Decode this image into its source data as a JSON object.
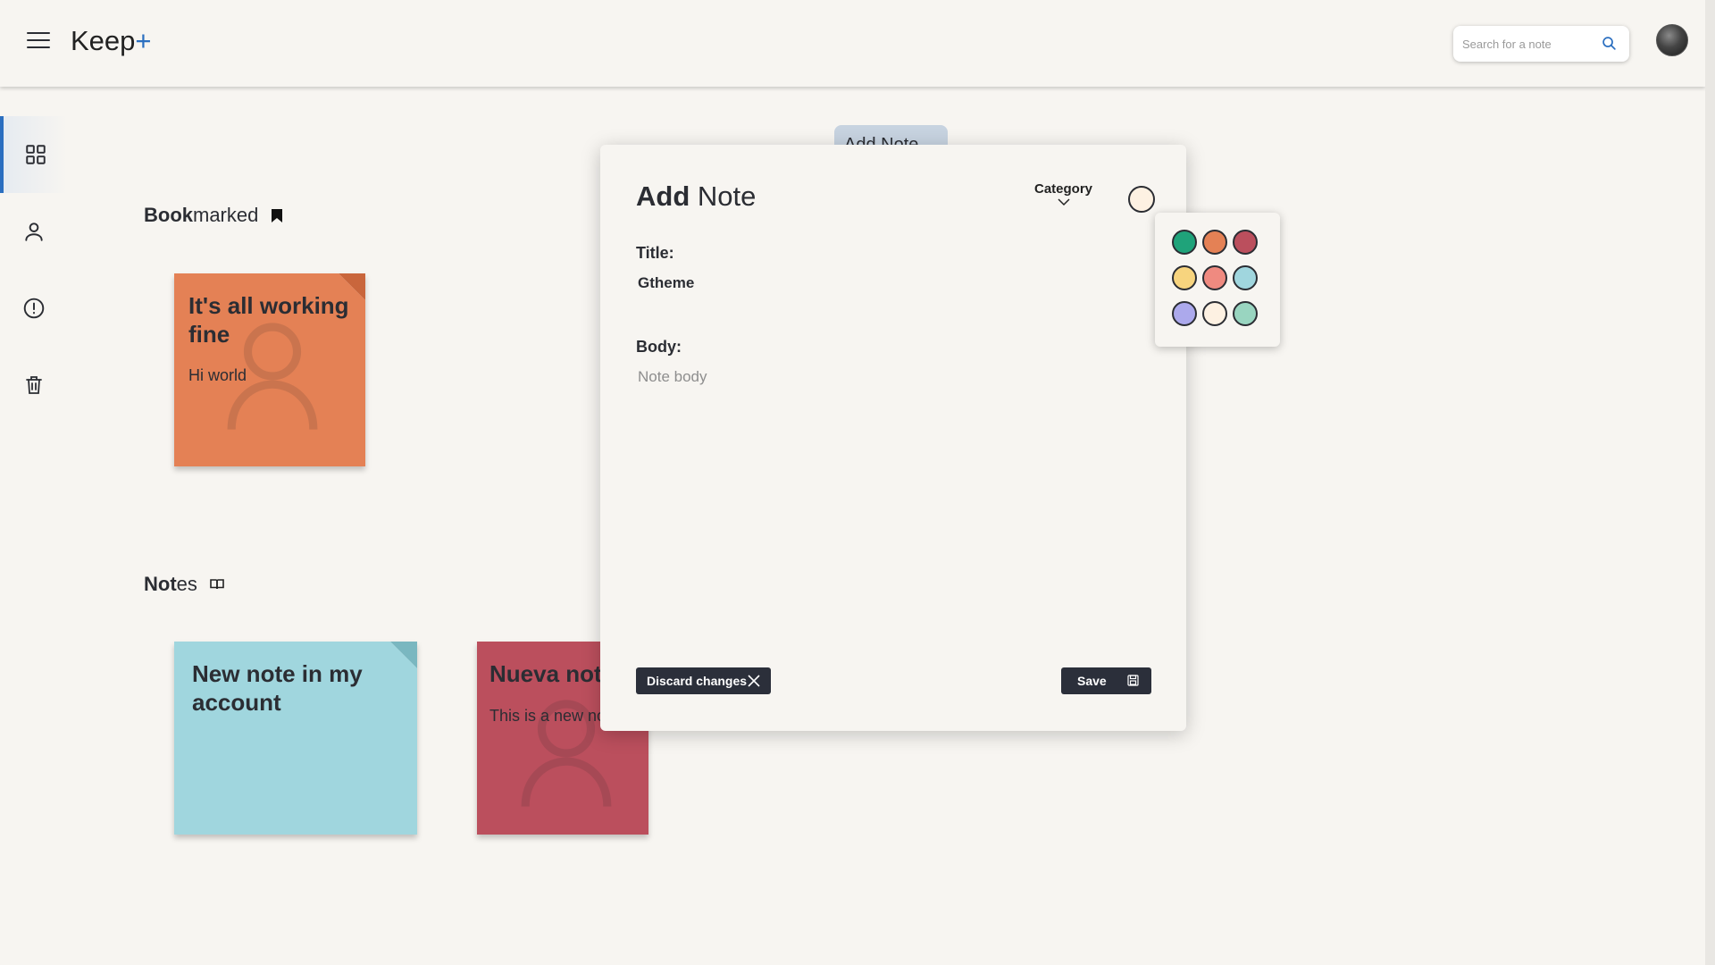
{
  "header": {
    "brand": "Keep",
    "brand_plus": "+",
    "search_placeholder": "Search for a note"
  },
  "sidebar": {
    "items": [
      {
        "name": "dashboard",
        "icon": "grid-icon",
        "active": true
      },
      {
        "name": "account",
        "icon": "user-icon",
        "active": false
      },
      {
        "name": "info",
        "icon": "alert-circle-icon",
        "active": false
      },
      {
        "name": "trash",
        "icon": "trash-icon",
        "active": false
      }
    ]
  },
  "sections": {
    "bookmarked_bold": "Book",
    "bookmarked_rest": "marked",
    "notes_bold": "Not",
    "notes_rest": "es"
  },
  "bookmarked_notes": [
    {
      "title": "It's all working fine",
      "body": "Hi world",
      "color": "#e48155"
    }
  ],
  "notes": [
    {
      "title": "New note in my account",
      "body": "",
      "color": "#a0d6de"
    },
    {
      "title": "Nueva nota",
      "body": "This is a new note",
      "color": "#bb4f5d"
    }
  ],
  "add_tab_label": "Add Note",
  "modal": {
    "title_bold": "Add",
    "title_rest": "Note",
    "category_label": "Category",
    "title_label": "Title:",
    "title_value": "Gtheme",
    "body_label": "Body:",
    "body_placeholder": "Note body",
    "discard_label": "Discard changes",
    "save_label": "Save"
  },
  "palette": {
    "colors": [
      "#1fa37a",
      "#e48155",
      "#bb4f5d",
      "#f7d47e",
      "#ef8a80",
      "#a0d6de",
      "#aca9ec",
      "#fdf1e2",
      "#99d5c0"
    ]
  },
  "colors": {
    "accent": "#2b6fc0",
    "background": "#f7f5f1",
    "button_dark": "#2b2f3a"
  }
}
